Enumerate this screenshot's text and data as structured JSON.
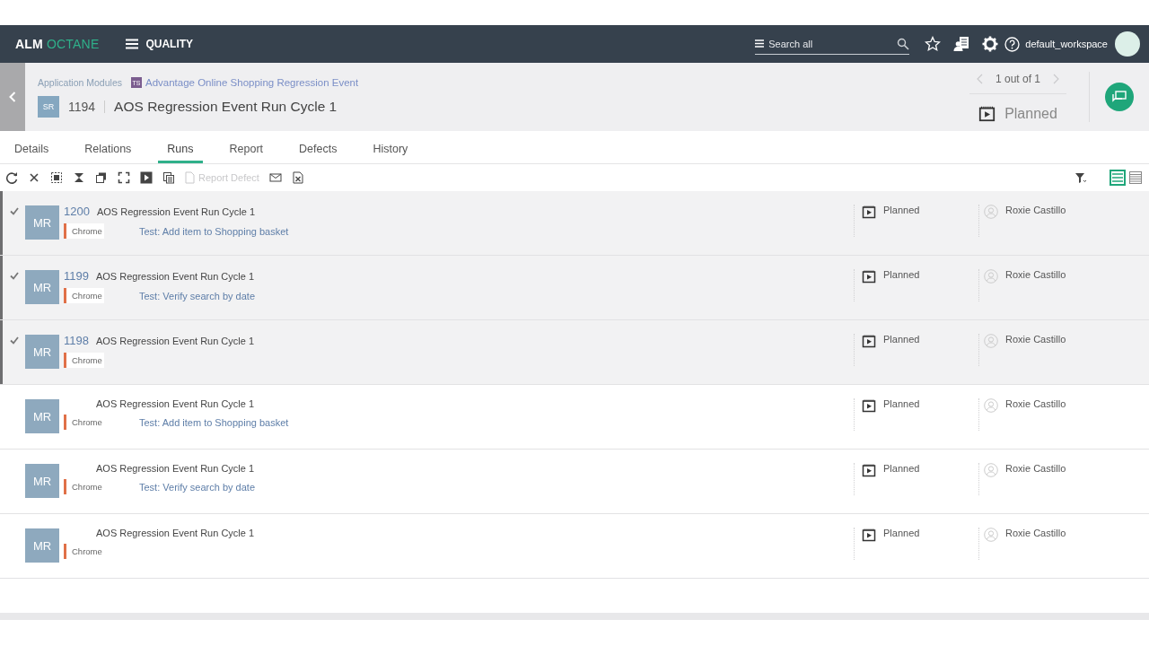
{
  "header": {
    "logo_primary": "ALM",
    "logo_secondary": "OCTANE",
    "module": "QUALITY",
    "search": {
      "placeholder": "Search all"
    },
    "workspace": "default_workspace"
  },
  "entity": {
    "breadcrumbs": [
      {
        "text": "Application Modules"
      },
      {
        "badge": "TS",
        "text": "Advantage Online Shopping Regression Event"
      }
    ],
    "type_badge": "SR",
    "id": "1194",
    "title": "AOS Regression Event Run Cycle 1",
    "pager": "1 out of 1",
    "phase": "Planned"
  },
  "tabs": [
    {
      "label": "Details",
      "selected": false
    },
    {
      "label": "Relations",
      "selected": false
    },
    {
      "label": "Runs",
      "selected": true
    },
    {
      "label": "Report",
      "selected": false
    },
    {
      "label": "Defects",
      "selected": false
    },
    {
      "label": "History",
      "selected": false
    }
  ],
  "toolbar": {
    "report_defect": {
      "label": "Report Defect",
      "disabled": true
    },
    "views": [
      {
        "kind": "list",
        "selected": true
      },
      {
        "kind": "grid",
        "selected": false
      }
    ]
  },
  "rows": [
    {
      "selected": true,
      "avatar": "MR",
      "id": "1200",
      "title": "AOS Regression Event Run Cycle 1",
      "tag": "Chrome",
      "test": "Test: Add item to Shopping basket",
      "phase": "Planned",
      "owner": "Roxie Castillo"
    },
    {
      "selected": true,
      "avatar": "MR",
      "id": "1199",
      "title": "AOS Regression Event Run Cycle 1",
      "tag": "Chrome",
      "test": "Test: Verify search by date",
      "phase": "Planned",
      "owner": "Roxie Castillo"
    },
    {
      "selected": true,
      "avatar": "MR",
      "id": "1198",
      "title": "AOS Regression Event Run Cycle 1",
      "tag": "Chrome",
      "phase": "Planned",
      "owner": "Roxie Castillo"
    },
    {
      "selected": false,
      "avatar": "MR",
      "title": "AOS Regression Event Run Cycle 1",
      "tag": "Chrome",
      "test": "Test: Add item to Shopping basket",
      "phase": "Planned",
      "owner": "Roxie Castillo"
    },
    {
      "selected": false,
      "avatar": "MR",
      "title": "AOS Regression Event Run Cycle 1",
      "tag": "Chrome",
      "test": "Test: Verify search by date",
      "phase": "Planned",
      "owner": "Roxie Castillo"
    },
    {
      "selected": false,
      "avatar": "MR",
      "title": "AOS Regression Event Run Cycle 1",
      "tag": "Chrome",
      "phase": "Planned",
      "owner": "Roxie Castillo"
    }
  ]
}
